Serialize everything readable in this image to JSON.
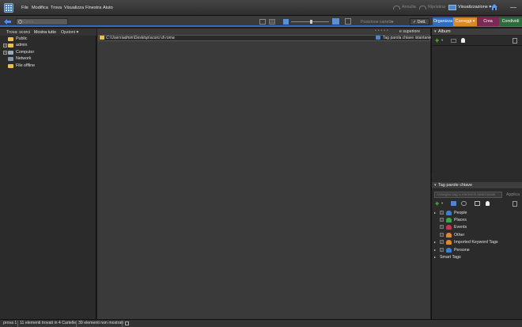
{
  "menu": {
    "items": [
      "File",
      "Modifica",
      "Trova",
      "Visualizza",
      "Finestra",
      "Aiuto"
    ],
    "undo_label": "Annulla",
    "redo_label": "Ripristina",
    "view_label": "Visualizzazione"
  },
  "toolbar": {
    "search_placeholder": "Cerca",
    "folder_position_label": "Posizione cartella",
    "details_label": "Dett."
  },
  "tabs": [
    {
      "label": "Organizza",
      "color": "#2f6dbf"
    },
    {
      "label": "Correggi",
      "color": "#d88a2a"
    },
    {
      "label": "Crea",
      "color": "#7a2a55"
    },
    {
      "label": "Condividi",
      "color": "#2e6b3a"
    }
  ],
  "left_panel": {
    "find_label": "Trova: scorci",
    "show_all_label": "Mostra tutto",
    "options_label": "Opzioni",
    "tree": [
      {
        "label": "Public",
        "expandable": false
      },
      {
        "label": "admin",
        "expandable": true
      },
      {
        "label": "Computer",
        "expandable": true
      },
      {
        "label": "Network",
        "expandable": false
      },
      {
        "label": "File offline",
        "expandable": false
      }
    ]
  },
  "center": {
    "rating_suffix": "e superiore",
    "path": "C:\\Users\\admin\\Desktop\\scorci di roma",
    "tag_hint": "Tag parola chiave istantaneo"
  },
  "right_panel": {
    "album_title": "Album",
    "keyword_tags_title": "Tag parole chiave",
    "assign_placeholder": "Assegna tag a elementi selezionati",
    "apply_label": "Applica",
    "keywords": [
      {
        "label": "People",
        "color": "#3a7fd0",
        "expandable": true
      },
      {
        "label": "Places",
        "color": "#3fa34d",
        "expandable": false
      },
      {
        "label": "Events",
        "color": "#c9344a",
        "expandable": false
      },
      {
        "label": "Other",
        "color": "#d98a2b",
        "expandable": false
      },
      {
        "label": "Imported Keyword Tags",
        "color": "#d98a2b",
        "expandable": true
      },
      {
        "label": "Persone",
        "color": "#3a7fd0",
        "expandable": true
      }
    ],
    "smart_tags_label": "Smart Tags"
  },
  "status": {
    "name": "prova 1",
    "found": "11 elementi trovati in 4 Cartelle",
    "hidden": "39 elementi non mostrati"
  }
}
